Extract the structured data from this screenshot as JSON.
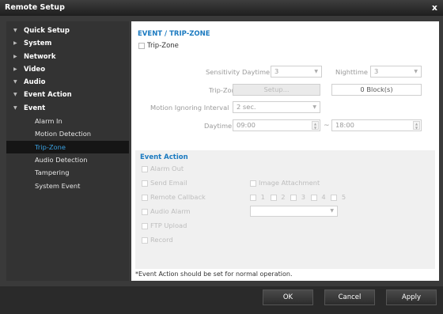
{
  "window": {
    "title": "Remote Setup",
    "close_label": "x"
  },
  "sidebar": {
    "items": [
      {
        "label": "Quick Setup",
        "arrow": "▼"
      },
      {
        "label": "System",
        "arrow": "▶"
      },
      {
        "label": "Network",
        "arrow": "▶"
      },
      {
        "label": "Video",
        "arrow": "▶"
      },
      {
        "label": "Audio",
        "arrow": "▼"
      },
      {
        "label": "Event Action",
        "arrow": "▼"
      },
      {
        "label": "Event",
        "arrow": "▼"
      }
    ],
    "sub_items": [
      {
        "label": "Alarm In"
      },
      {
        "label": "Motion Detection"
      },
      {
        "label": "Trip-Zone",
        "active": true
      },
      {
        "label": "Audio Detection"
      },
      {
        "label": "Tampering"
      },
      {
        "label": "System Event"
      }
    ]
  },
  "main": {
    "section_title": "EVENT / TRIP-ZONE",
    "tripzone_checkbox_label": "Trip-Zone",
    "sensitivity_label": "Sensitivity",
    "daytime_label": "Daytime",
    "daytime_value": "3",
    "nighttime_label": "Nighttime",
    "nighttime_value": "3",
    "tripzone_label": "Trip-Zone",
    "setup_button": "Setup...",
    "blocks_value": "0 Block(s)",
    "motion_ignoring_label": "Motion Ignoring Interval",
    "motion_ignoring_value": "2 sec.",
    "daytime_range_label": "Daytime",
    "daytime_start": "09:00",
    "daytime_end": "18:00",
    "range_separator": "~"
  },
  "event_action": {
    "title": "Event Action",
    "alarm_out": "Alarm Out",
    "send_email": "Send Email",
    "image_attachment": "Image Attachment",
    "remote_callback": "Remote Callback",
    "callback_numbers": [
      "1",
      "2",
      "3",
      "4",
      "5"
    ],
    "audio_alarm": "Audio Alarm",
    "ftp_upload": "FTP Upload",
    "record": "Record"
  },
  "footnote": "*Event Action should be set for normal operation.",
  "buttons": {
    "ok": "OK",
    "cancel": "Cancel",
    "apply": "Apply"
  }
}
